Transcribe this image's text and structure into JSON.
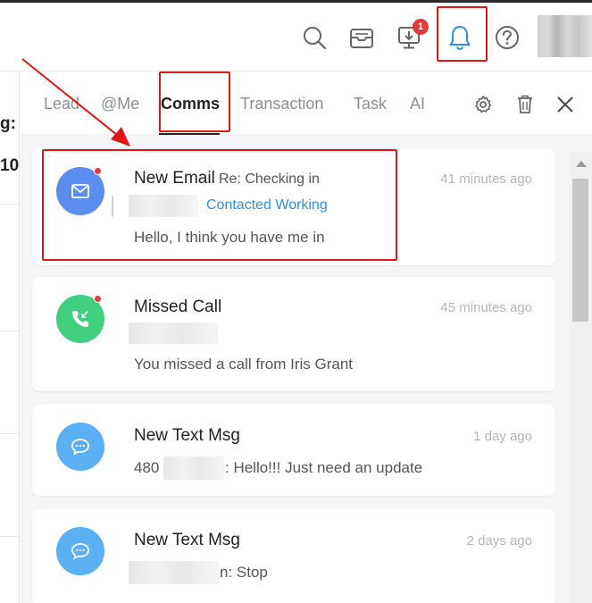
{
  "left_panel": {
    "label_1": "g:",
    "label_2": "10"
  },
  "topbar": {
    "icons": [
      "search-icon",
      "inbox-icon",
      "download-icon",
      "bell-icon",
      "help-icon"
    ],
    "notification_count": "1"
  },
  "tabs": [
    {
      "label": "Lead",
      "active": false
    },
    {
      "label": "@Me",
      "active": false
    },
    {
      "label": "Comms",
      "active": true
    },
    {
      "label": "Transaction",
      "active": false
    },
    {
      "label": "Task",
      "active": false
    },
    {
      "label": "AI",
      "active": false
    }
  ],
  "notifications": [
    {
      "type": "email",
      "title": "New Email",
      "subject": "Re: Checking in",
      "tags": "Contacted Working",
      "time": "41 minutes ago",
      "message": "Hello, I think you have me in",
      "unread": true,
      "icon": "mail-icon",
      "color": "#5b8def"
    },
    {
      "type": "call",
      "title": "Missed Call",
      "time": "45 minutes ago",
      "message": "You missed a call from Iris Grant",
      "unread": true,
      "icon": "phone-missed-icon",
      "color": "#3fcf7e"
    },
    {
      "type": "text",
      "title": "New Text Msg",
      "time": "1 day ago",
      "message_prefix": "480",
      "message": ": Hello!!! Just need an update",
      "icon": "chat-icon",
      "color": "#5ab0f2"
    },
    {
      "type": "text",
      "title": "New Text Msg",
      "time": "2 days ago",
      "message": "n: Stop",
      "icon": "chat-icon",
      "color": "#5ab0f2"
    }
  ],
  "colors": {
    "highlight": "#e01515",
    "tag_blue": "#2f8fe0",
    "unread_dot": "#e23b3b"
  }
}
